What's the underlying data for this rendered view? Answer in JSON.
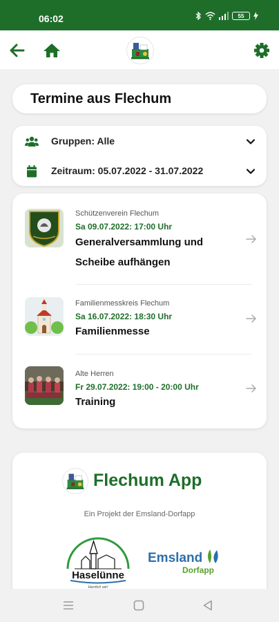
{
  "status_bar": {
    "time": "06:02",
    "battery": "55"
  },
  "app_bar": {
    "back_icon": "arrow-left-icon",
    "home_icon": "home-icon",
    "settings_icon": "gear-icon"
  },
  "page": {
    "title": "Termine aus Flechum"
  },
  "filters": {
    "groups_label": "Gruppen: Alle",
    "period_label": "Zeitraum: 05.07.2022 - 31.07.2022"
  },
  "events": [
    {
      "club": "Schützenverein Flechum",
      "date": "Sa 09.07.2022: 17:00 Uhr",
      "title_line1": "Generalversammlung und",
      "title_line2": "Scheibe aufhängen"
    },
    {
      "club": "Familienmesskreis Flechum",
      "date": "Sa 16.07.2022: 18:30 Uhr",
      "title_line1": "Familienmesse"
    },
    {
      "club": "Alte Herren",
      "date": "Fr 29.07.2022: 19:00 - 20:00 Uhr",
      "title_line1": "Training"
    }
  ],
  "footer": {
    "app_name": "Flechum App",
    "subtitle": "Ein Projekt der Emsland-Dorfapp",
    "partner1_name": "Haselünne",
    "partner1_slogan": "Herrlich wir!",
    "partner2_name": "Emsland",
    "partner2_sub": "Dorfapp"
  },
  "colors": {
    "primary_green": "#1e6e2a",
    "emsland_blue": "#2b6fad",
    "dorfapp_green": "#5aa02c"
  }
}
